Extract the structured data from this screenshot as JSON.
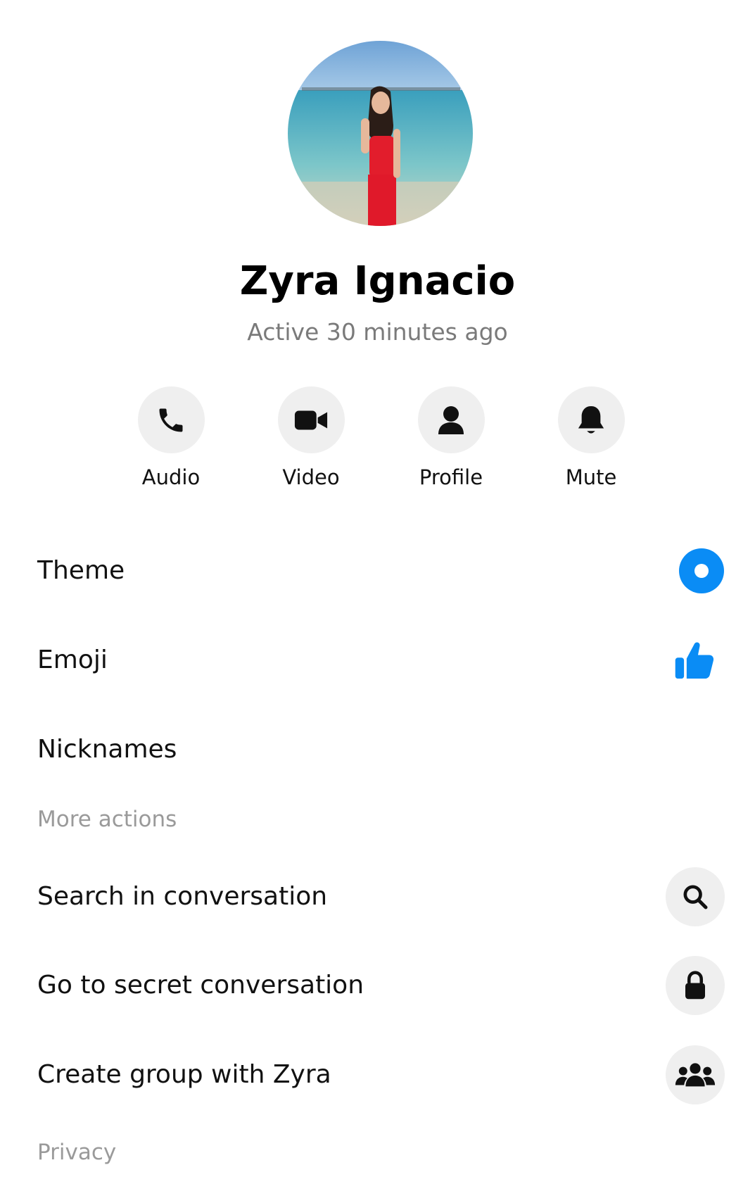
{
  "profile": {
    "name": "Zyra Ignacio",
    "status": "Active 30 minutes ago"
  },
  "quick_actions": [
    {
      "label": "Audio",
      "icon": "phone-icon"
    },
    {
      "label": "Video",
      "icon": "video-camera-icon"
    },
    {
      "label": "Profile",
      "icon": "person-icon"
    },
    {
      "label": "Mute",
      "icon": "bell-icon"
    }
  ],
  "settings": {
    "theme_label": "Theme",
    "emoji_label": "Emoji",
    "nicknames_label": "Nicknames"
  },
  "more_actions": {
    "header": "More actions",
    "search_label": "Search in conversation",
    "secret_label": "Go to secret conversation",
    "group_label": "Create group with Zyra"
  },
  "privacy": {
    "header": "Privacy"
  },
  "colors": {
    "accent": "#0A8CF5",
    "icon_bg": "#EFEFEF",
    "secondary_text": "#7A7A7A"
  }
}
